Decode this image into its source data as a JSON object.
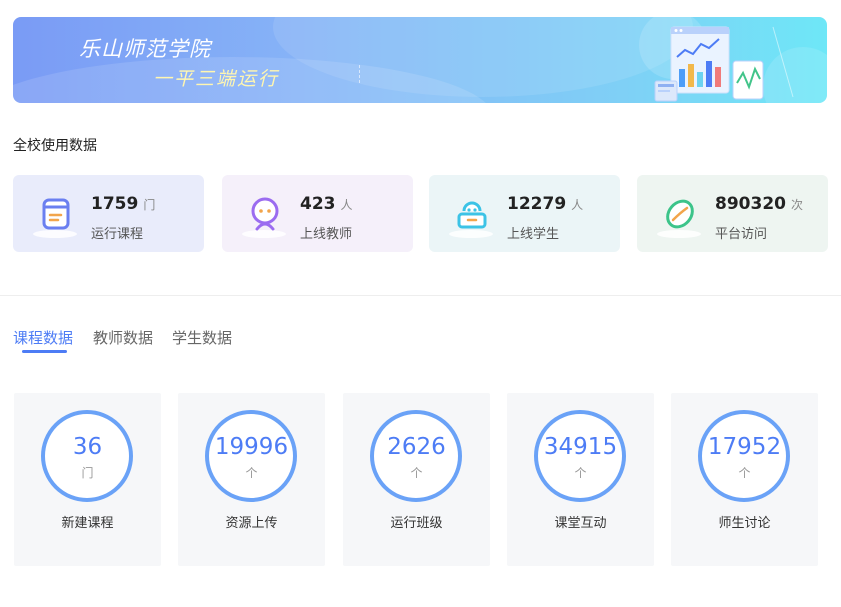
{
  "banner": {
    "title": "乐山师范学院",
    "subtitle": "一平三端运行"
  },
  "overview": {
    "title": "全校使用数据",
    "cards": [
      {
        "value": "1759",
        "unit": "门",
        "label": "运行课程",
        "icon": "book-icon",
        "bg": "#e9ecfb"
      },
      {
        "value": "423",
        "unit": "人",
        "label": "上线教师",
        "icon": "teacher-icon",
        "bg": "#f5f0fa"
      },
      {
        "value": "12279",
        "unit": "人",
        "label": "上线学生",
        "icon": "student-icon",
        "bg": "#ebf5f7"
      },
      {
        "value": "890320",
        "unit": "次",
        "label": "平台访问",
        "icon": "visit-icon",
        "bg": "#eef5f1"
      }
    ]
  },
  "tabs": [
    {
      "label": "课程数据",
      "active": true
    },
    {
      "label": "教师数据",
      "active": false
    },
    {
      "label": "学生数据",
      "active": false
    }
  ],
  "metrics": [
    {
      "value": "36",
      "unit": "门",
      "label": "新建课程"
    },
    {
      "value": "19996",
      "unit": "个",
      "label": "资源上传"
    },
    {
      "value": "2626",
      "unit": "个",
      "label": "运行班级"
    },
    {
      "value": "34915",
      "unit": "个",
      "label": "课堂互动"
    },
    {
      "value": "17952",
      "unit": "个",
      "label": "师生讨论"
    }
  ],
  "colors": {
    "accent": "#4d7cf5",
    "ring": "#6aa2f7"
  }
}
